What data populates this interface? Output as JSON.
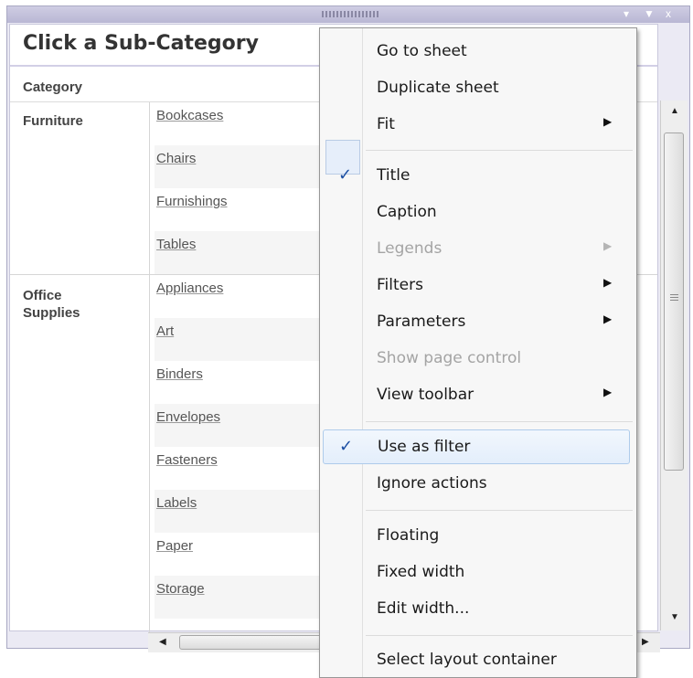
{
  "sheet": {
    "title": "Click a Sub-Category",
    "column_header": "Category"
  },
  "table": {
    "groups": [
      {
        "category": "Furniture",
        "subcategories": [
          "Bookcases",
          "Chairs",
          "Furnishings",
          "Tables"
        ]
      },
      {
        "category": "Office Supplies",
        "subcategories": [
          "Appliances",
          "Art",
          "Binders",
          "Envelopes",
          "Fasteners",
          "Labels",
          "Paper",
          "Storage"
        ]
      }
    ]
  },
  "window_controls": {
    "minimize_icon": "down-arrow",
    "filter_icon": "funnel",
    "close_glyph": "x"
  },
  "context_menu": {
    "items": [
      {
        "label": "Go to sheet",
        "state": "enabled"
      },
      {
        "label": "Duplicate sheet",
        "state": "enabled"
      },
      {
        "label": "Fit",
        "state": "enabled",
        "submenu": true
      },
      {
        "label": "Title",
        "state": "enabled",
        "checked": true
      },
      {
        "label": "Caption",
        "state": "enabled"
      },
      {
        "label": "Legends",
        "state": "disabled",
        "submenu": true
      },
      {
        "label": "Filters",
        "state": "enabled",
        "submenu": true
      },
      {
        "label": "Parameters",
        "state": "enabled",
        "submenu": true
      },
      {
        "label": "Show page control",
        "state": "disabled"
      },
      {
        "label": "View toolbar",
        "state": "enabled",
        "submenu": true
      },
      {
        "label": "Use as filter",
        "state": "highlighted",
        "checked": true
      },
      {
        "label": "Ignore actions",
        "state": "enabled"
      },
      {
        "label": "Floating",
        "state": "enabled"
      },
      {
        "label": "Fixed width",
        "state": "enabled"
      },
      {
        "label": "Edit width...",
        "state": "enabled"
      },
      {
        "label": "Select layout container",
        "state": "enabled"
      }
    ],
    "check_glyph": "✓",
    "submenu_glyph": "▶"
  },
  "colors": {
    "accent_check": "#1c4fa3",
    "highlight_bg": "#e3eefb",
    "highlight_border": "#aecbeb",
    "frame": "#ebeaf4"
  }
}
